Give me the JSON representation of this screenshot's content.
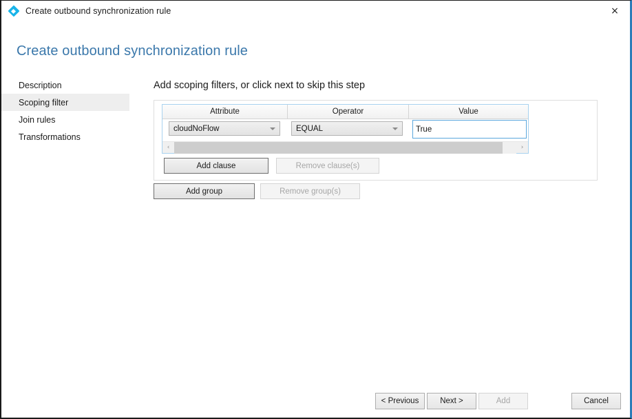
{
  "window": {
    "title": "Create outbound synchronization rule",
    "app_icon": "sync-rule-diamond-icon",
    "close_label": "×",
    "accent_color": "#2b7cb8"
  },
  "page": {
    "heading": "Create outbound synchronization rule",
    "heading_color": "#3b78ab"
  },
  "sidebar": {
    "items": [
      {
        "label": "Description",
        "selected": false
      },
      {
        "label": "Scoping filter",
        "selected": true
      },
      {
        "label": "Join rules",
        "selected": false
      },
      {
        "label": "Transformations",
        "selected": false
      }
    ]
  },
  "main": {
    "heading": "Add scoping filters, or click next to skip this step",
    "grid": {
      "columns": [
        "Attribute",
        "Operator",
        "Value"
      ],
      "rows": [
        {
          "attribute": "cloudNoFlow",
          "operator": "EQUAL",
          "value": "True"
        }
      ],
      "scrollbar": {
        "left_arrow": "‹",
        "right_arrow": "›",
        "thumb_percent": 96
      },
      "focused_field": "value",
      "focus_border_color": "#5aa7dd"
    },
    "clause_buttons": {
      "add_label": "Add clause",
      "add_enabled": true,
      "remove_label": "Remove clause(s)",
      "remove_enabled": false
    },
    "group_buttons": {
      "add_label": "Add group",
      "add_enabled": true,
      "remove_label": "Remove group(s)",
      "remove_enabled": false
    }
  },
  "footer": {
    "previous_label": "< Previous",
    "next_label": "Next >",
    "add_label": "Add",
    "add_enabled": false,
    "cancel_label": "Cancel"
  }
}
